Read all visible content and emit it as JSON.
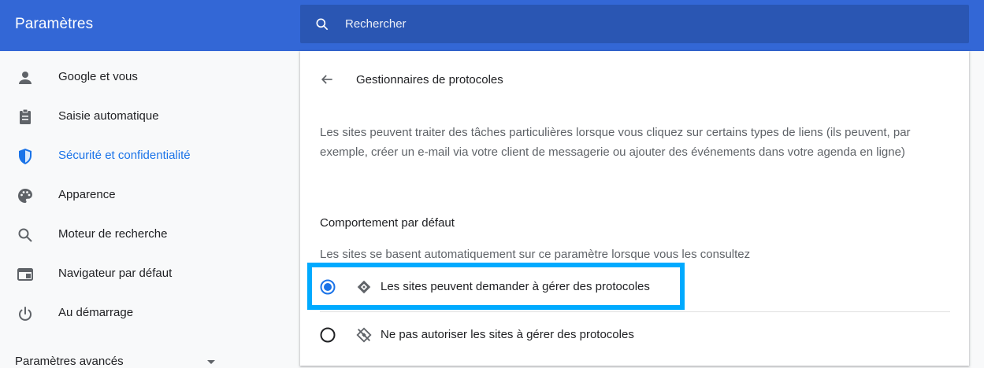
{
  "header": {
    "title": "Paramètres",
    "search_placeholder": "Rechercher"
  },
  "sidebar": {
    "items": [
      {
        "label": "Google et vous",
        "icon": "person-icon"
      },
      {
        "label": "Saisie automatique",
        "icon": "clipboard-icon"
      },
      {
        "label": "Sécurité et confidentialité",
        "icon": "shield-icon",
        "active": true
      },
      {
        "label": "Apparence",
        "icon": "palette-icon"
      },
      {
        "label": "Moteur de recherche",
        "icon": "search-icon"
      },
      {
        "label": "Navigateur par défaut",
        "icon": "browser-window-icon"
      },
      {
        "label": "Au démarrage",
        "icon": "power-icon"
      }
    ],
    "advanced_label": "Paramètres avancés"
  },
  "main": {
    "title": "Gestionnaires de protocoles",
    "description": "Les sites peuvent traiter des tâches particulières lorsque vous cliquez sur certains types de liens (ils peuvent, par exemple, créer un e-mail via votre client de messagerie ou ajouter des événements dans votre agenda en ligne)",
    "section_title": "Comportement par défaut",
    "section_description": "Les sites se basent automatiquement sur ce paramètre lorsque vous les consultez",
    "options": [
      {
        "label": "Les sites peuvent demander à gérer des protocoles",
        "selected": true,
        "icon": "protocol-handler-icon"
      },
      {
        "label": "Ne pas autoriser les sites à gérer des protocoles",
        "selected": false,
        "icon": "protocol-handler-off-icon"
      }
    ]
  },
  "colors": {
    "header": "#3367d6",
    "search_box": "#2a56b3",
    "accent": "#1a73e8",
    "highlight": "#00aaff"
  }
}
